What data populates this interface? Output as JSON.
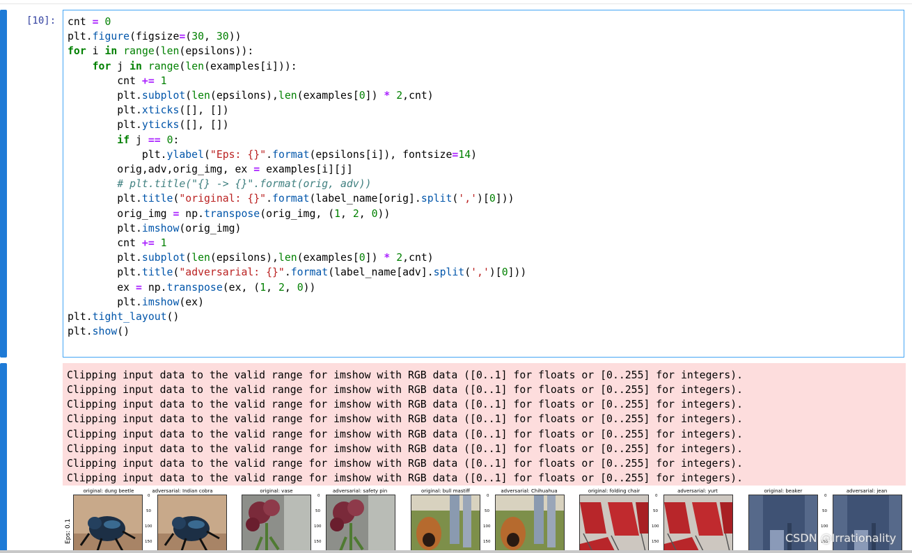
{
  "cell": {
    "prompt": "[10]:",
    "code_lines": [
      "cnt = 0",
      "plt.figure(figsize=(30, 30))",
      "for i in range(len(epsilons)):",
      "    for j in range(len(examples[i])):",
      "        cnt += 1",
      "        plt.subplot(len(epsilons),len(examples[0]) * 2,cnt)",
      "        plt.xticks([], [])",
      "        plt.yticks([], [])",
      "        if j == 0:",
      "            plt.ylabel(\"Eps: {}\".format(epsilons[i]), fontsize=14)",
      "        orig,adv,orig_img, ex = examples[i][j]",
      "        # plt.title(\"{} -> {}\".format(orig, adv))",
      "        plt.title(\"original: {}\".format(label_name[orig].split(',')[0]))",
      "        orig_img = np.transpose(orig_img, (1, 2, 0))",
      "        plt.imshow(orig_img)",
      "        cnt += 1",
      "        plt.subplot(len(epsilons),len(examples[0]) * 2,cnt)",
      "        plt.title(\"adversarial: {}\".format(label_name[adv].split(',')[0]))",
      "        ex = np.transpose(ex, (1, 2, 0))",
      "        plt.imshow(ex)",
      "plt.tight_layout()",
      "plt.show()"
    ]
  },
  "stderr": {
    "lines": [
      "Clipping input data to the valid range for imshow with RGB data ([0..1] for floats or [0..255] for integers).",
      "Clipping input data to the valid range for imshow with RGB data ([0..1] for floats or [0..255] for integers).",
      "Clipping input data to the valid range for imshow with RGB data ([0..1] for floats or [0..255] for integers).",
      "Clipping input data to the valid range for imshow with RGB data ([0..1] for floats or [0..255] for integers).",
      "Clipping input data to the valid range for imshow with RGB data ([0..1] for floats or [0..255] for integers).",
      "Clipping input data to the valid range for imshow with RGB data ([0..1] for floats or [0..255] for integers).",
      "Clipping input data to the valid range for imshow with RGB data ([0..1] for floats or [0..255] for integers).",
      "Clipping input data to the valid range for imshow with RGB data ([0..1] for floats or [0..255] for integers)."
    ]
  },
  "figure": {
    "ylabel": "Eps: 0.1",
    "yticks": [
      "0",
      "50",
      "100",
      "150"
    ],
    "subplots": [
      {
        "title": "original: dung beetle",
        "image": "dung-beetle-image"
      },
      {
        "title": "adversarial: Indian cobra",
        "image": "dung-beetle-image"
      },
      {
        "title": "original: vase",
        "image": "vase-flowers-image"
      },
      {
        "title": "adversarial: safety pin",
        "image": "vase-flowers-image"
      },
      {
        "title": "original: bull mastiff",
        "image": "bull-mastiff-image"
      },
      {
        "title": "adversarial: Chihuahua",
        "image": "bull-mastiff-image"
      },
      {
        "title": "original: folding chair",
        "image": "folding-chair-image"
      },
      {
        "title": "adversarial: yurt",
        "image": "folding-chair-image"
      },
      {
        "title": "original: beaker",
        "image": "beaker-image"
      },
      {
        "title": "adversarial: jean",
        "image": "beaker-image"
      }
    ]
  },
  "watermark": "CSDN @Irrationality",
  "colors": {
    "cell_accent": "#1e7ad6",
    "stderr_bg": "#fddddd",
    "keyword": "#008000",
    "operator": "#aa22ff",
    "string": "#ba2121",
    "comment": "#408080"
  }
}
